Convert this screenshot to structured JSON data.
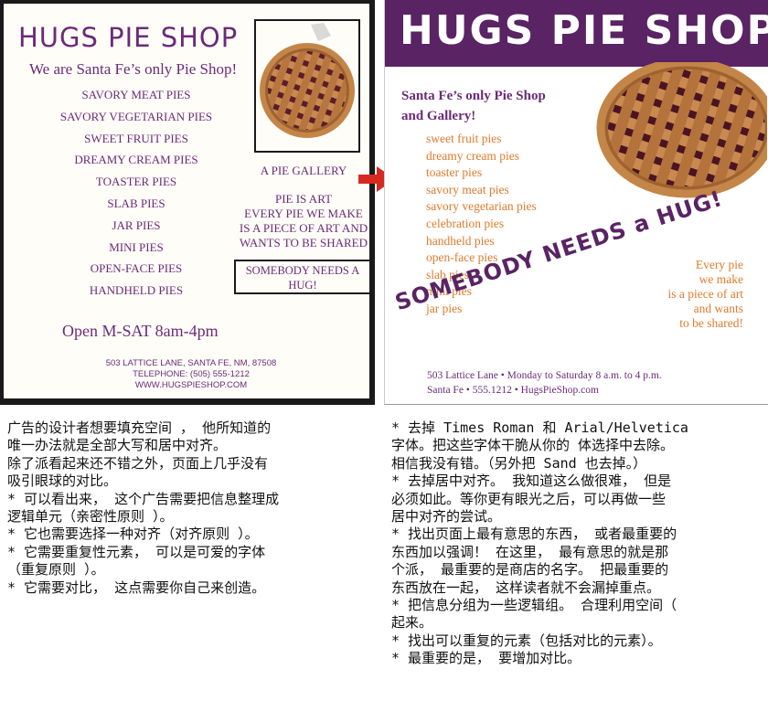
{
  "left_ad": {
    "logo": "HUGS PIE SHOP",
    "tagline": "We are Santa Fe’s only Pie Shop!",
    "menu": [
      "SAVORY MEAT PIES",
      "SAVORY VEGETARIAN PIES",
      "SWEET FRUIT PIES",
      "DREAMY CREAM PIES",
      "TOASTER PIES",
      "SLAB PIES",
      "JAR PIES",
      "MINI PIES",
      "OPEN-FACE PIES",
      "HANDHELD PIES"
    ],
    "gallery": "A PIE GALLERY",
    "art_lines": [
      "PIE IS ART",
      "EVERY PIE WE MAKE",
      "IS A PIECE OF ART AND",
      "WANTS TO BE SHARED"
    ],
    "hug_lines": [
      "SOMEBODY NEEDS A",
      "HUG!"
    ],
    "hours": "Open M-SAT 8am-4pm",
    "contact_lines": [
      "503 LATTICE LANE, SANTA FE, NM, 87508",
      "TELEPHONE: (505) 555-1212",
      "WWW.HUGSPIESHOP.COM"
    ]
  },
  "right_ad": {
    "logo": "HUGS PIE SHOP",
    "headline_lines": [
      "Santa Fe’s only Pie Shop",
      "and Gallery!"
    ],
    "menu": [
      "sweet fruit pies",
      "dreamy cream pies",
      "toaster pies",
      "savory meat pies",
      "savory vegetarian pies",
      "celebration pies",
      "handheld pies",
      "open-face pies",
      "slab pies",
      "mini pies",
      "jar pies"
    ],
    "slogan": "SOMEBODY NEEDS a HUG!",
    "art_lines": [
      "Every pie",
      "we make",
      "is a piece of art",
      "and wants",
      "to be shared!"
    ],
    "footer_lines": [
      "503 Lattice Lane • Monday to Saturday 8 a.m. to 4 p.m.",
      "Santa Fe • 555.1212 • HugsPieShop.com"
    ]
  },
  "commentary_left": [
    "广告的设计者想要填充空间 ， 他所知道的",
    "唯一办法就是全部大写和居中对齐。",
    "除了派看起来还不错之外，页面上几乎没有",
    "吸引眼球的对比。",
    "* 可以看出来， 这个广告需要把信息整理成",
    "逻辑单元（亲密性原则 ）。",
    "* 它也需要选择一种对齐（对齐原则 ）。",
    "* 它需要重复性元素， 可以是可爱的字体",
    "（重复原则 ）。",
    "* 它需要对比， 这点需要你自己来创造。"
  ],
  "commentary_right": [
    "* 去掉 Times Roman 和 Arial/Helvetica",
    "字体。把这些字体干脆从你的 体选择中去除。",
    "相信我没有错。（另外把 Sand 也去掉。）",
    "* 去掉居中对齐。 我知道这么做很难， 但是",
    "必须如此。等你更有眼光之后，可以再做一些",
    "居中对齐的尝试。",
    "* 找出页面上最有意思的东西， 或者最重要的",
    "东西加以强调！ 在这里， 最有意思的就是那",
    "个派， 最重要的是商店的名字。 把最重要的",
    "东西放在一起， 这样读者就不会漏掉重点。",
    "* 把信息分组为一些逻辑组。 合理利用空间（",
    "起来。",
    "* 找出可以重复的元素（包括对比的元素）。",
    "* 最重要的是， 要增加对比。"
  ],
  "colors": {
    "brand_purple": "#5a2364",
    "text_purple": "#6b2a78",
    "menu_orange": "#e07b2d",
    "arrow_red": "#d42a1f"
  }
}
